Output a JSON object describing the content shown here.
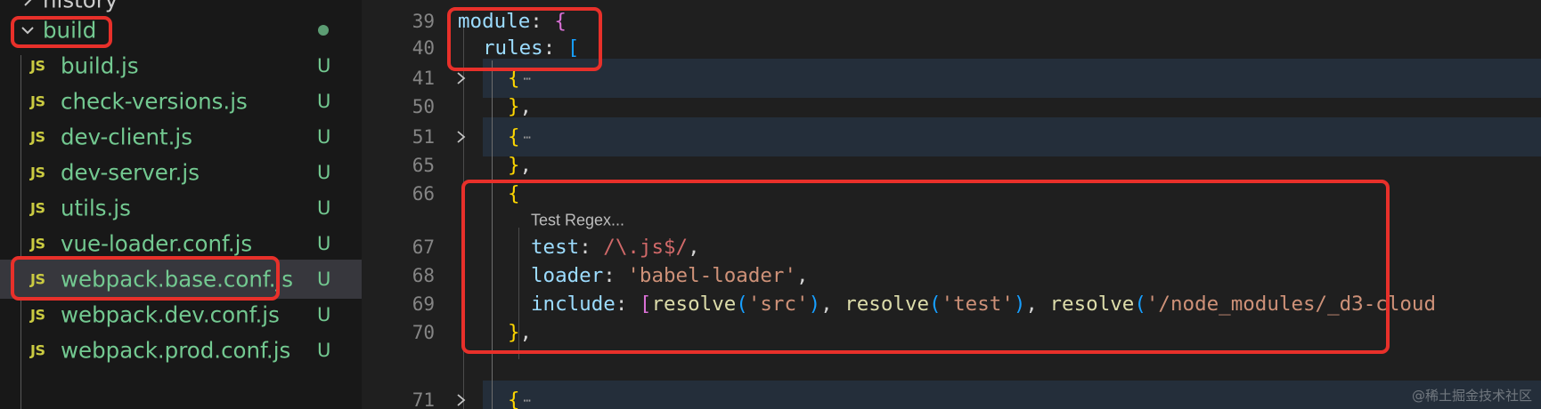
{
  "explorer": {
    "partial_item": {
      "label": "history"
    },
    "folder": {
      "label": "build",
      "status_color": "#73c991"
    },
    "files": [
      {
        "icon_label": "JS",
        "label": "build.js",
        "status": "U"
      },
      {
        "icon_label": "JS",
        "label": "check-versions.js",
        "status": "U"
      },
      {
        "icon_label": "JS",
        "label": "dev-client.js",
        "status": "U"
      },
      {
        "icon_label": "JS",
        "label": "dev-server.js",
        "status": "U"
      },
      {
        "icon_label": "JS",
        "label": "utils.js",
        "status": "U"
      },
      {
        "icon_label": "JS",
        "label": "vue-loader.conf.js",
        "status": "U"
      },
      {
        "icon_label": "JS",
        "label": "webpack.base.conf.js",
        "status": "U",
        "selected": true
      },
      {
        "icon_label": "JS",
        "label": "webpack.dev.conf.js",
        "status": "U"
      },
      {
        "icon_label": "JS",
        "label": "webpack.prod.conf.js",
        "status": "U"
      }
    ]
  },
  "editor": {
    "lines": [
      {
        "num": "39",
        "tokens": [
          "module",
          ": ",
          "{"
        ]
      },
      {
        "num": "40",
        "tokens": [
          "rules",
          ": ",
          "["
        ]
      },
      {
        "num": "41",
        "folded": true,
        "tokens": [
          "{",
          "⋯"
        ]
      },
      {
        "num": "50",
        "tokens": [
          "}",
          ","
        ]
      },
      {
        "num": "51",
        "folded": true,
        "tokens": [
          "{",
          "⋯"
        ]
      },
      {
        "num": "65",
        "tokens": [
          "}",
          ","
        ]
      },
      {
        "num": "66",
        "tokens": [
          "{"
        ]
      },
      {
        "num": "",
        "hint": "Test Regex..."
      },
      {
        "num": "67",
        "tokens": [
          "test",
          ": ",
          "/\\.js$/",
          ","
        ]
      },
      {
        "num": "68",
        "tokens": [
          "loader",
          ": ",
          "'babel-loader'",
          ","
        ]
      },
      {
        "num": "69",
        "tokens": [
          "include",
          ": ",
          "[",
          "resolve",
          "(",
          "'src'",
          ")",
          ", ",
          "resolve",
          "(",
          "'test'",
          ")",
          ", ",
          "resolve",
          "(",
          "'/node_modules/_d3-cloud"
        ]
      },
      {
        "num": "70",
        "tokens": [
          "}",
          ","
        ]
      },
      {
        "num": "71",
        "folded": true,
        "tokens": [
          "{",
          "⋯"
        ]
      }
    ]
  },
  "colors": {
    "annotation_box": "#e8302a",
    "untracked_file": "#73c991",
    "js_icon": "#cbcb41",
    "property": "#9cdcfe",
    "string": "#ce9178",
    "function": "#dcdcaa",
    "regex": "#d16969"
  },
  "watermark": "@稀土掘金技术社区"
}
